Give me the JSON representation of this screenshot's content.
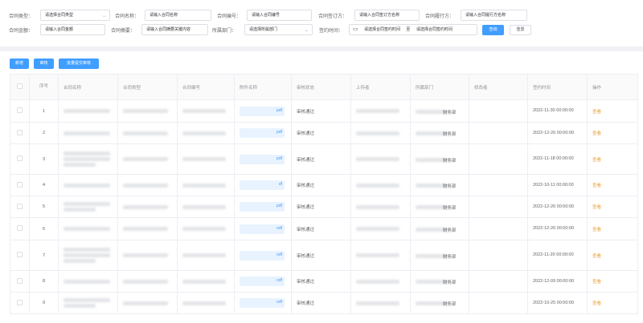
{
  "filters": {
    "contract_type": {
      "label": "合同类型：",
      "placeholder": "请选择合同类型"
    },
    "contract_name": {
      "label": "合同名称：",
      "placeholder": "请输入合同名称"
    },
    "contract_no": {
      "label": "合同编号：",
      "placeholder": "请输入合同编号"
    },
    "signing_party": {
      "label": "合同签订方：",
      "placeholder": "请输入合同签订方名称"
    },
    "performing_party": {
      "label": "合同履行方：",
      "placeholder": "请输入合同履行方名称"
    },
    "amount": {
      "label": "合同金额：",
      "placeholder": "请输入合同金额"
    },
    "summary": {
      "label": "合同摘要：",
      "placeholder": "请输入合同摘要关键内容"
    },
    "department": {
      "label": "所属部门：",
      "placeholder": "请选择所属部门"
    },
    "sign_time": {
      "label": "签约时间：",
      "start_placeholder": "请选择合同签约时间",
      "separator": "至",
      "end_placeholder": "请选择合同签约时间"
    },
    "search_label": "查询",
    "reset_label": "重置"
  },
  "toolbar": {
    "add_label": "新增",
    "audit_label": "审核",
    "batch_label": "批量提交审核"
  },
  "table": {
    "headers": {
      "seq": "序号",
      "name": "合同名称",
      "type": "合同类型",
      "no": "合同编号",
      "attachment": "附件名称",
      "status": "审核状态",
      "uploader": "上传者",
      "dept": "所属部门",
      "modifier": "修改者",
      "sign_time": "签约时间",
      "action": "操作"
    },
    "rows": [
      {
        "seq": "1",
        "attachment_ext": "pdf",
        "status": "审核通过",
        "dept_suffix": "财务部",
        "time": "2022-11-30 00:00:00",
        "action": "查看"
      },
      {
        "seq": "2",
        "attachment_ext": "pdf",
        "status": "审核通过",
        "dept_suffix": "财务部",
        "time": "2022-12-26 00:00:00",
        "action": "查看"
      },
      {
        "seq": "3",
        "attachment_ext": "pdf",
        "status": "审核通过",
        "dept_suffix": "财务部",
        "time": "2022-11-18 00:00:00",
        "action": "查看"
      },
      {
        "seq": "4",
        "attachment_ext": "df",
        "status": "审核通过",
        "dept_suffix": "财务部",
        "time": "2022-10-11 00:00:00",
        "action": "查看"
      },
      {
        "seq": "5",
        "attachment_ext": "pdf",
        "status": "审核通过",
        "dept_suffix": "财务部",
        "time": "2022-12-26 00:00:00",
        "action": "查看"
      },
      {
        "seq": "6",
        "attachment_ext": "odf",
        "status": "审核通过",
        "dept_suffix": "财务部",
        "time": "2022-12-26 00:00:00",
        "action": "查看"
      },
      {
        "seq": "7",
        "attachment_ext": "odf",
        "status": "审核通过",
        "dept_suffix": "财务部",
        "time": "2022-11-20 00:00:00",
        "action": "查看"
      },
      {
        "seq": "8",
        "attachment_ext": "odf",
        "status": "审核通过",
        "dept_suffix": "财务部",
        "time": "2022-12-09 00:00:00",
        "action": "查看"
      },
      {
        "seq": "9",
        "attachment_ext": "odf",
        "status": "审核通过",
        "dept_suffix": "财务部",
        "time": "2022-10-25 00:00:00",
        "action": "查看"
      }
    ]
  },
  "colors": {
    "primary": "#409eff",
    "link": "#e6a23c",
    "border": "#ebeef5",
    "background": "#f0f2f5"
  }
}
